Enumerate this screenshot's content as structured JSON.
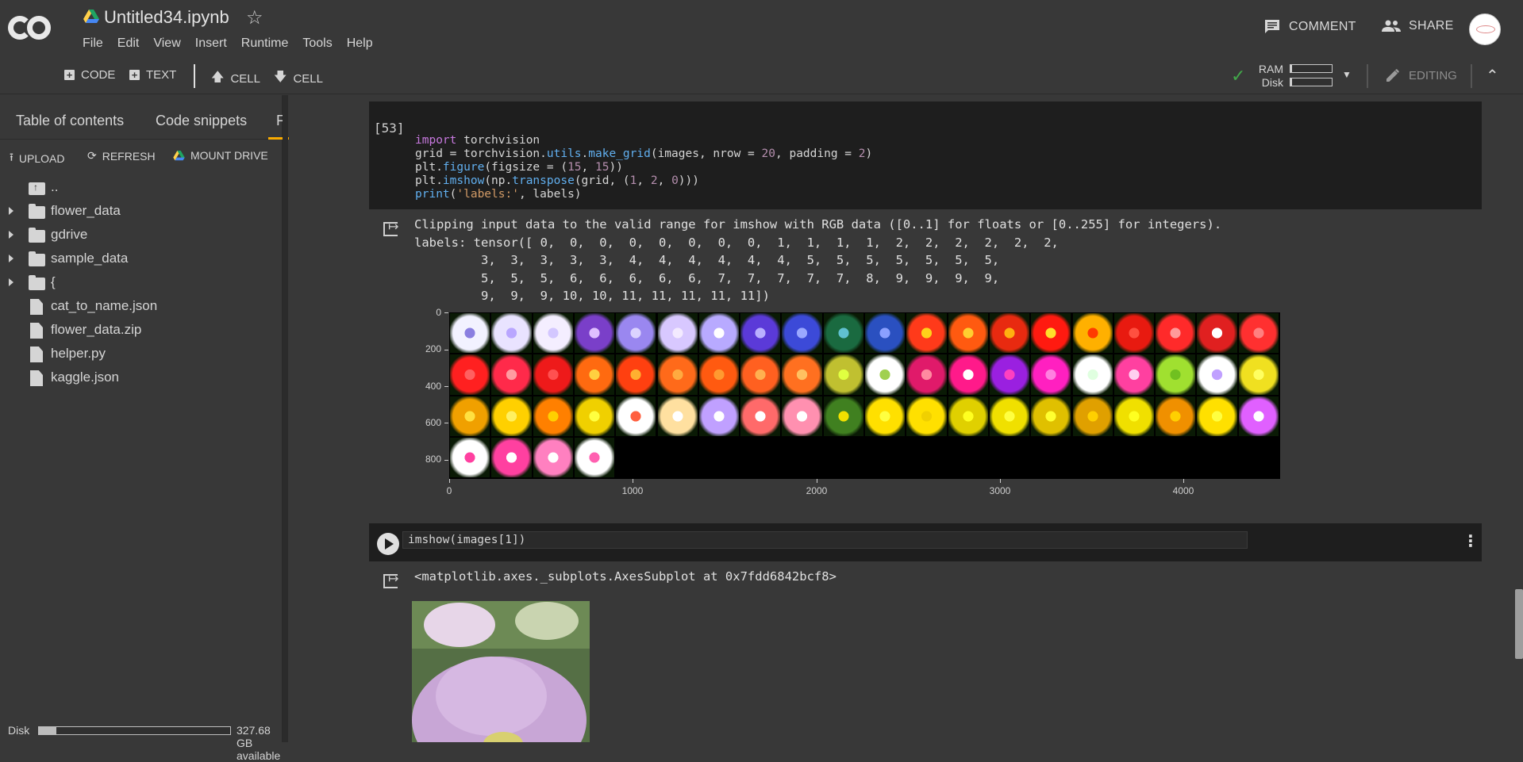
{
  "header": {
    "title": "Untitled34.ipynb",
    "menu": [
      "File",
      "Edit",
      "View",
      "Insert",
      "Runtime",
      "Tools",
      "Help"
    ],
    "comment_label": "COMMENT",
    "share_label": "SHARE"
  },
  "toolbar": {
    "add_code": "CODE",
    "add_text": "TEXT",
    "cell_up": "CELL",
    "cell_down": "CELL",
    "ram_label": "RAM",
    "disk_label": "Disk",
    "ram_fraction": 0.03,
    "disk_fraction": 0.03,
    "editing_label": "EDITING"
  },
  "sidebar": {
    "tabs": [
      "Table of contents",
      "Code snippets",
      "Files"
    ],
    "active_tab": "Files",
    "actions": {
      "upload": "UPLOAD",
      "refresh": "REFRESH",
      "mount": "MOUNT DRIVE"
    },
    "tree": [
      {
        "type": "parent",
        "name": ".."
      },
      {
        "type": "folder",
        "name": "flower_data"
      },
      {
        "type": "folder",
        "name": "gdrive"
      },
      {
        "type": "folder",
        "name": "sample_data"
      },
      {
        "type": "folder",
        "name": "{"
      },
      {
        "type": "file",
        "name": "cat_to_name.json"
      },
      {
        "type": "file",
        "name": "flower_data.zip"
      },
      {
        "type": "file",
        "name": "helper.py"
      },
      {
        "type": "file",
        "name": "kaggle.json"
      }
    ],
    "disk_label": "Disk",
    "disk_available": "327.68 GB available",
    "disk_used_fraction": 0.09
  },
  "cell1": {
    "execution_count": "[53]",
    "code_lines": [
      "import torchvision",
      "grid = torchvision.utils.make_grid(images, nrow = 20, padding = 2)",
      "plt.figure(figsize = (15, 15))",
      "plt.imshow(np.transpose(grid, (1, 2, 0)))",
      "print('labels:', labels)"
    ],
    "output_lines": [
      "Clipping input data to the valid range for imshow with RGB data ([0..1] for floats or [0..255] for integers).",
      "labels: tensor([ 0,  0,  0,  0,  0,  0,  0,  0,  1,  1,  1,  1,  2,  2,  2,  2,  2,  2,",
      "         3,  3,  3,  3,  3,  4,  4,  4,  4,  4,  4,  5,  5,  5,  5,  5,  5,  5,",
      "         5,  5,  5,  6,  6,  6,  6,  6,  7,  7,  7,  7,  7,  8,  9,  9,  9,  9,",
      "         9,  9,  9, 10, 10, 11, 11, 11, 11, 11])"
    ],
    "plot": {
      "y_ticks": [
        "0",
        "200",
        "400",
        "600",
        "800"
      ],
      "x_ticks": [
        "0",
        "1000",
        "2000",
        "3000",
        "4000"
      ]
    }
  },
  "cell2": {
    "code": "imshow(images[1])",
    "output": "<matplotlib.axes._subplots.AxesSubplot at 0x7fdd6842bcf8>"
  },
  "colors": {
    "background": "#383838",
    "cell_bg": "#1e1e1e",
    "accent": "#f9ab00",
    "check_green": "#42a84a"
  }
}
